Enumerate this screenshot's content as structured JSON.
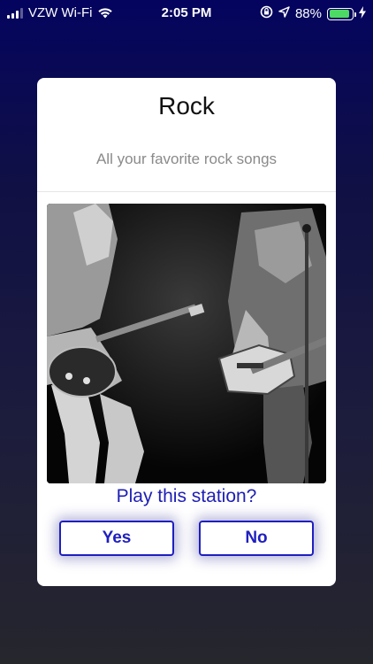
{
  "status_bar": {
    "carrier": "VZW Wi-Fi",
    "time": "2:05 PM",
    "battery_percent": "88%",
    "battery_level": 0.88,
    "icons": [
      "signal-icon",
      "wifi-icon",
      "orientation-lock-icon",
      "location-icon",
      "battery-icon",
      "charging-icon"
    ]
  },
  "station": {
    "title": "Rock",
    "subtitle": "All your favorite rock songs",
    "image": "guitarists-on-stage-photo"
  },
  "prompt": {
    "question": "Play this station?",
    "yes_label": "Yes",
    "no_label": "No"
  },
  "colors": {
    "accent": "#1f1fc0",
    "battery": "#4cd964",
    "background_top": "#04045f",
    "background_bottom": "#26262d"
  }
}
